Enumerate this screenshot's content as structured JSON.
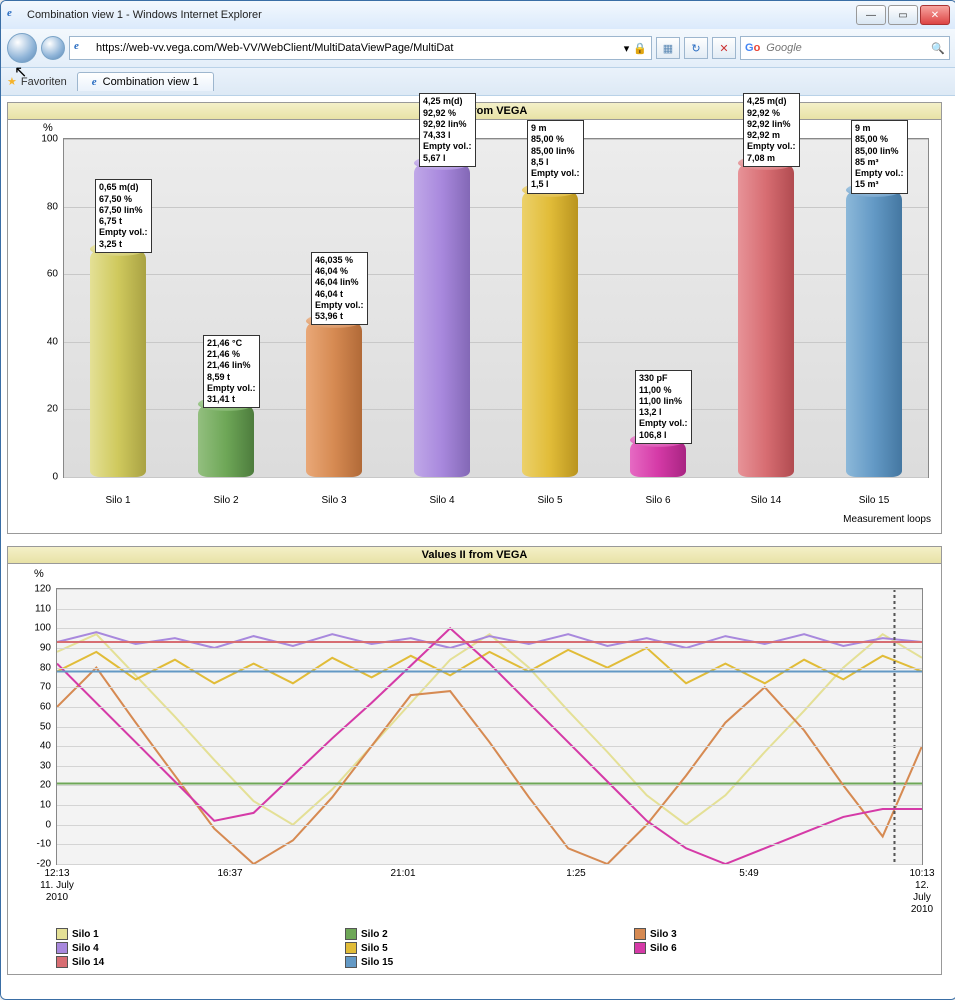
{
  "window": {
    "title": "Combination view 1 - Windows Internet Explorer"
  },
  "address": {
    "url": "https://web-vv.vega.com/Web-VV/WebClient/MultiDataViewPage/MultiDat"
  },
  "search": {
    "placeholder": "Google"
  },
  "favorites_label": "Favoriten",
  "tab": {
    "label": "Combination view 1"
  },
  "panel_title": "Values II from VEGA",
  "axis_y_unit": "%",
  "axis_x_title": "Measurement loops",
  "chart_data": {
    "type": "bar",
    "ylim": [
      0,
      100
    ],
    "y_ticks": [
      0,
      20,
      40,
      60,
      80,
      100
    ],
    "ylabel": "%",
    "xlabel": "Measurement loops",
    "categories": [
      "Silo 1",
      "Silo 2",
      "Silo 3",
      "Silo 4",
      "Silo 5",
      "Silo 6",
      "Silo 14",
      "Silo 15"
    ],
    "values": [
      67.5,
      21.46,
      46.04,
      92.92,
      85.0,
      11.0,
      92.92,
      85.0
    ],
    "data_labels": [
      "0,65 m(d)\n67,50 %\n67,50 lin%\n6,75 t\nEmpty vol.:\n3,25 t",
      "21,46 °C\n21,46 %\n21,46 lin%\n8,59 t\nEmpty vol.:\n31,41 t",
      "46,035 %\n46,04 %\n46,04 lin%\n46,04 t\nEmpty vol.:\n53,96 t",
      "4,25 m(d)\n92,92 %\n92,92 lin%\n74,33 l\nEmpty vol.:\n5,67 l",
      "9 m\n85,00 %\n85,00 lin%\n8,5 l\nEmpty vol.:\n1,5 l",
      "330 pF\n11,00 %\n11,00 lin%\n13,2 l\nEmpty vol.:\n106,8 l",
      "4,25 m(d)\n92,92 %\n92,92 lin%\n92,92 m\nEmpty vol.:\n7,08 m",
      "9 m\n85,00 %\n85,00 lin%\n85 m³\nEmpty vol.:\n15 m³"
    ],
    "colors": [
      "#cfc95d",
      "#6ea757",
      "#d68a52",
      "#a888dd",
      "#e1bc38",
      "#d53aa7",
      "#d76d72",
      "#6399c5"
    ]
  },
  "line_panel_title": "Values II from VEGA",
  "line_y_unit": "%",
  "line_x_ticks": [
    {
      "t": "12:13",
      "d": "11. July",
      "y": "2010"
    },
    {
      "t": "16:37",
      "d": "",
      "y": ""
    },
    {
      "t": "21:01",
      "d": "",
      "y": ""
    },
    {
      "t": "1:25",
      "d": "",
      "y": ""
    },
    {
      "t": "5:49",
      "d": "",
      "y": ""
    },
    {
      "t": "10:13",
      "d": "12. July",
      "y": "2010"
    }
  ],
  "line_chart": {
    "type": "line",
    "ylim": [
      -20,
      120
    ],
    "y_ticks": [
      -20,
      -10,
      0,
      10,
      20,
      30,
      40,
      50,
      60,
      70,
      80,
      90,
      100,
      110,
      120
    ],
    "x": [
      0,
      1,
      2,
      3,
      4,
      5,
      6,
      7,
      8,
      9,
      10,
      11,
      12,
      13,
      14,
      15,
      16,
      17,
      18,
      19,
      20,
      21,
      22
    ],
    "series": [
      {
        "name": "Silo 1",
        "color": "#e4e096",
        "values": [
          88,
          97,
          76,
          55,
          33,
          12,
          0,
          18,
          40,
          62,
          84,
          97,
          80,
          58,
          37,
          15,
          0,
          15,
          37,
          58,
          80,
          97,
          85
        ]
      },
      {
        "name": "Silo 2",
        "color": "#6ea757",
        "values": [
          21,
          21,
          21,
          21,
          21,
          21,
          21,
          21,
          21,
          21,
          21,
          21,
          21,
          21,
          21,
          21,
          21,
          21,
          21,
          21,
          21,
          21,
          21
        ]
      },
      {
        "name": "Silo 3",
        "color": "#d68a52",
        "values": [
          60,
          80,
          52,
          25,
          -2,
          -20,
          -8,
          14,
          40,
          66,
          68,
          42,
          14,
          -12,
          -20,
          0,
          25,
          52,
          70,
          48,
          20,
          -6,
          40
        ]
      },
      {
        "name": "Silo 4",
        "color": "#a888dd",
        "values": [
          93,
          98,
          92,
          95,
          90,
          96,
          91,
          97,
          92,
          95,
          90,
          96,
          92,
          97,
          91,
          95,
          90,
          96,
          92,
          97,
          91,
          95,
          93
        ]
      },
      {
        "name": "Silo 5",
        "color": "#e1bc38",
        "values": [
          78,
          88,
          74,
          84,
          72,
          82,
          72,
          85,
          75,
          86,
          76,
          88,
          78,
          89,
          80,
          90,
          72,
          82,
          72,
          84,
          74,
          86,
          78
        ]
      },
      {
        "name": "Silo 6",
        "color": "#d53aa7",
        "values": [
          82,
          62,
          42,
          22,
          2,
          6,
          25,
          44,
          62,
          81,
          100,
          82,
          62,
          42,
          22,
          2,
          -12,
          -20,
          -12,
          -4,
          4,
          8,
          8
        ]
      },
      {
        "name": "Silo 14",
        "color": "#d76d72",
        "values": [
          93,
          93,
          93,
          93,
          93,
          93,
          93,
          93,
          93,
          93,
          93,
          93,
          93,
          93,
          93,
          93,
          93,
          93,
          93,
          93,
          93,
          93,
          93
        ]
      },
      {
        "name": "Silo 15",
        "color": "#6399c5",
        "values": [
          78,
          78,
          78,
          78,
          78,
          78,
          78,
          78,
          78,
          78,
          78,
          78,
          78,
          78,
          78,
          78,
          78,
          78,
          78,
          78,
          78,
          78,
          78
        ]
      }
    ]
  }
}
